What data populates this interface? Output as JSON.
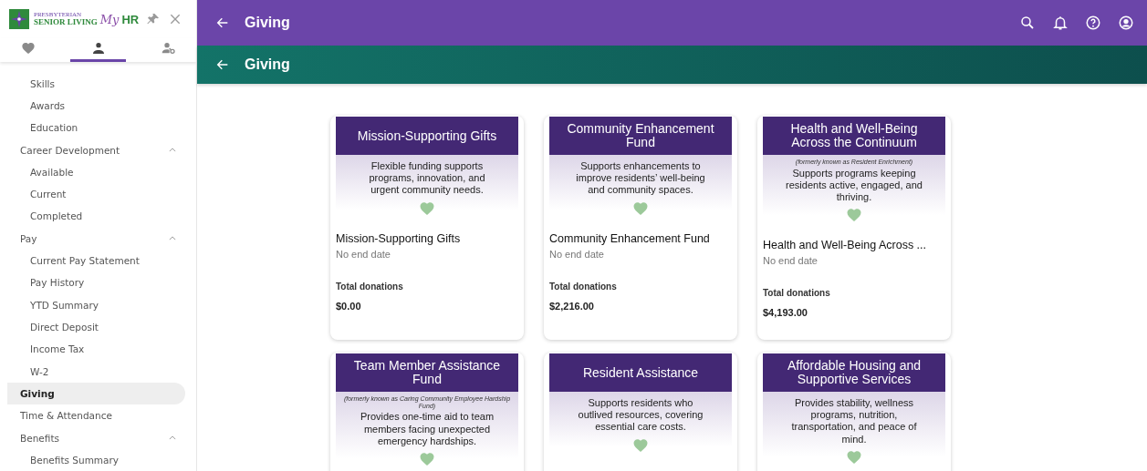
{
  "logo": {
    "line_1": "PRESBYTERIAN",
    "line_2": "SENIOR LIVING",
    "script": "My",
    "suffix": "HR"
  },
  "sidebar_tabs": [
    {
      "kind": "favorites",
      "selected": false
    },
    {
      "kind": "profile",
      "selected": true
    },
    {
      "kind": "admin",
      "selected": false
    }
  ],
  "nav": {
    "continued": [
      {
        "label": "Skills"
      },
      {
        "label": "Awards"
      },
      {
        "label": "Education"
      }
    ],
    "items": [
      {
        "label": "Career Development",
        "selected": false,
        "expanded": true,
        "children": [
          {
            "label": "Available"
          },
          {
            "label": "Current"
          },
          {
            "label": "Completed"
          }
        ]
      },
      {
        "label": "Pay",
        "selected": false,
        "expanded": true,
        "children": [
          {
            "label": "Current Pay Statement"
          },
          {
            "label": "Pay History"
          },
          {
            "label": "YTD Summary"
          },
          {
            "label": "Direct Deposit"
          },
          {
            "label": "Income Tax"
          },
          {
            "label": "W-2"
          }
        ]
      },
      {
        "label": "Giving",
        "selected": true
      },
      {
        "label": "Time & Attendance",
        "selected": false
      },
      {
        "label": "Benefits",
        "selected": false,
        "expanded": true,
        "children": [
          {
            "label": "Benefits Summary"
          }
        ]
      }
    ]
  },
  "top_bar": {
    "title": "Giving"
  },
  "sub_bar": {
    "title": "Giving"
  },
  "cards": [
    {
      "banner_title": "Mission-Supporting Gifts",
      "description": "Flexible funding supports programs, innovation, and urgent community needs.",
      "name": "Mission-Supporting Gifts",
      "end_date": "No end date",
      "total_label": "Total donations",
      "total": "$0.00"
    },
    {
      "banner_title": "Community Enhancement Fund",
      "description": "Supports enhancements to improve residents’ well-being and community spaces.",
      "name": "Community Enhancement Fund",
      "end_date": "No end date",
      "total_label": "Total donations",
      "total": "$2,216.00"
    },
    {
      "banner_title": "Health and Well-Being Across the Continuum",
      "note": "(formerly known as Resident Enrichment)",
      "description": "Supports programs keeping residents active, engaged, and thriving.",
      "name": "Health and Well-Being Across ...",
      "end_date": "No end date",
      "total_label": "Total donations",
      "total": "$4,193.00"
    },
    {
      "banner_title": "Team Member Assistance Fund",
      "note": "(formerly known as Caring Community Employee Hardship Fund)",
      "description": "Provides one-time aid to team members facing unexpected emergency hardships."
    },
    {
      "banner_title": "Resident Assistance",
      "description": "Supports residents who outlived resources, covering essential care costs."
    },
    {
      "banner_title": "Affordable Housing and Supportive Services",
      "description": "Provides stability, wellness programs, nutrition, transportation, and peace of mind."
    }
  ]
}
